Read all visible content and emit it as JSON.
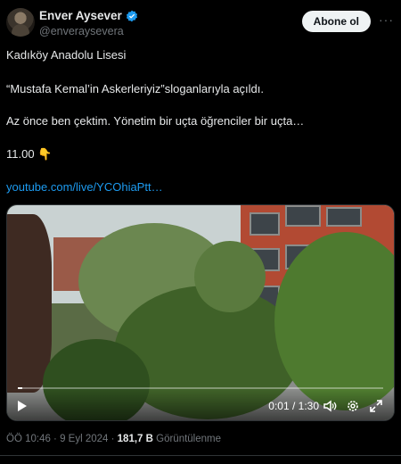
{
  "author": {
    "name": "Enver Aysever",
    "handle": "@enveraysevera",
    "verified": true,
    "verified_color": "#1d9bf0"
  },
  "follow_label": "Abone ol",
  "more_icon": "more-icon",
  "tweet": {
    "line1": "Kadıköy Anadolu Lisesi",
    "line2": "“Mustafa Kemal’in Askerleriyiz”sloganlarıyla açıldı.",
    "line3": "Az önce ben çektim. Yönetim bir uçta öğrenciler bir uçta…",
    "line4": "11.00 👇",
    "link": "youtube.com/live/YCOhiaPtt…"
  },
  "video": {
    "time": "0:01 / 1:30",
    "progress": 0.011
  },
  "footer": {
    "time": "ÖÖ 10:46 · 9 Eyl 2024 · ",
    "views_count": "181,7 B",
    "views_label": " Görüntülenme"
  },
  "colors": {
    "background": "#000000",
    "text": "#e7e9ea",
    "muted": "#71767b",
    "link": "#1d9bf0"
  }
}
